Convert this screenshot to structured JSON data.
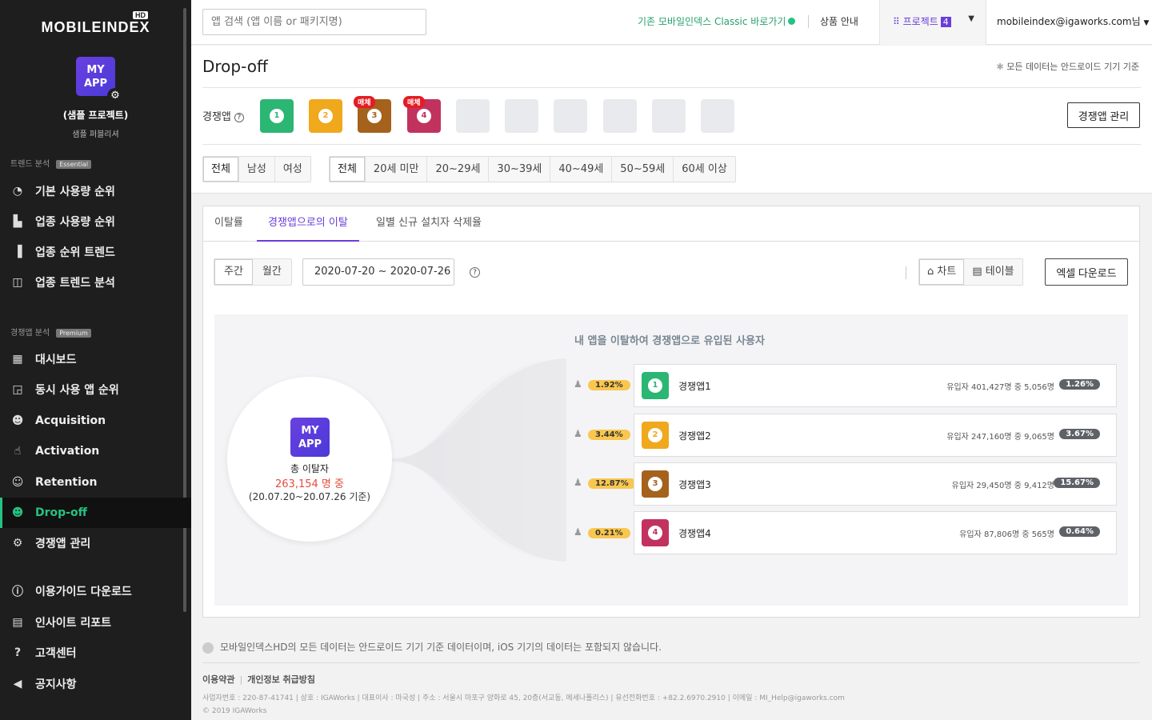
{
  "sidebar": {
    "logo": "MOBILEINDEX",
    "logo_badge": "HD",
    "app_icon_text": "MY\nAPP",
    "project_name": "(샘플 프로젝트)",
    "project_sub": "샘플 퍼블리셔",
    "sections": [
      {
        "title": "트렌드 분석",
        "badge": "Essential"
      },
      {
        "title": "경쟁앱 분석",
        "badge": "Premium"
      }
    ],
    "items": [
      {
        "label": "기본 사용량 순위",
        "icon": "gauge-icon"
      },
      {
        "label": "업종 사용량 순위",
        "icon": "building-icon"
      },
      {
        "label": "업종 순위 트렌드",
        "icon": "bar-chart-icon"
      },
      {
        "label": "업종 트렌드 분석",
        "icon": "trend-chart-icon"
      },
      {
        "label": "대시보드",
        "icon": "dashboard-icon"
      },
      {
        "label": "동시 사용 앱 순위",
        "icon": "overlap-icon"
      },
      {
        "label": "Acquisition",
        "icon": "user-plus-icon"
      },
      {
        "label": "Activation",
        "icon": "hand-pointer-icon"
      },
      {
        "label": "Retention",
        "icon": "user-refresh-icon"
      },
      {
        "label": "Drop-off",
        "icon": "user-minus-icon"
      },
      {
        "label": "경쟁앱 관리",
        "icon": "gear-icon"
      },
      {
        "label": "이용가이드 다운로드",
        "icon": "info-icon"
      },
      {
        "label": "인사이트 리포트",
        "icon": "report-icon"
      },
      {
        "label": "고객센터",
        "icon": "help-icon"
      },
      {
        "label": "공지사항",
        "icon": "megaphone-icon"
      }
    ]
  },
  "topbar": {
    "search_placeholder": "앱 검색 (앱 이름 or 패키지명)",
    "classic_link": "기존 모바일인덱스 Classic 바로가기",
    "product_info": "상품 안내",
    "project_label": "프로젝트",
    "project_count": "4",
    "email": "mobileindex@igaworks.com님"
  },
  "page": {
    "title": "Drop-off",
    "android_note": "모든 데이터는 안드로이드 기기 기준",
    "competitor_label": "경쟁앱",
    "competitor_help": "?",
    "competitors": [
      {
        "num": "1",
        "color": "#2bb673",
        "badge": ""
      },
      {
        "num": "2",
        "color": "#f0a81c",
        "badge": ""
      },
      {
        "num": "3",
        "color": "#a5621c",
        "badge": "매체"
      },
      {
        "num": "4",
        "color": "#c2325e",
        "badge": "매체"
      }
    ],
    "manage_button": "경쟁앱 관리",
    "gender_filters": [
      "전체",
      "남성",
      "여성"
    ],
    "age_filters": [
      "전체",
      "20세 미만",
      "20~29세",
      "30~39세",
      "40~49세",
      "50~59세",
      "60세 이상"
    ]
  },
  "tabs": [
    "이탈률",
    "경쟁앱으로의 이탈",
    "일별 신규 설치자 삭제율"
  ],
  "controls": {
    "period": [
      "주간",
      "월간"
    ],
    "date_range": "2020-07-20 ~ 2020-07-26",
    "help": "?",
    "view_chart": "차트",
    "view_table": "테이블",
    "excel": "엑셀 다운로드"
  },
  "flow": {
    "title": "내 앱을 이탈하여 경쟁앱으로 유입된 사용자",
    "center_app": "MY\nAPP",
    "center_l1": "총 이탈자",
    "center_l2": "263,154 명  중",
    "center_l3": "(20.07.20~20.07.26 기준)",
    "rows": [
      {
        "pct_left": "1.92%",
        "name": "경쟁앱1",
        "num": "1",
        "color": "#2bb673",
        "desc": "유입자 401,427명 중 5,056명",
        "pct_right": "1.26%"
      },
      {
        "pct_left": "3.44%",
        "name": "경쟁앱2",
        "num": "2",
        "color": "#f0a81c",
        "desc": "유입자 247,160명 중 9,065명",
        "pct_right": "3.67%"
      },
      {
        "pct_left": "12.87%",
        "name": "경쟁앱3",
        "num": "3",
        "color": "#a5621c",
        "desc": "유입자 29,450명 중 9,412명",
        "pct_right": "15.67%"
      },
      {
        "pct_left": "0.21%",
        "name": "경쟁앱4",
        "num": "4",
        "color": "#c2325e",
        "desc": "유입자 87,806명 중 565명",
        "pct_right": "0.64%"
      }
    ]
  },
  "footer": {
    "note": "모바일인덱스HD의 모든 데이터는 안드로이드 기기 기준 데이터이며, iOS 기기의 데이터는 포함되지 않습니다.",
    "terms": "이용약관",
    "privacy": "개인정보 취급방침",
    "info": "사업자번호 : 220-87-41741  |  상호 : IGAWorks  |  대표이사 : 마국성  |  주소 : 서울시 마포구 양화로 45, 20층(서교동, 메세나폴리스)  |  유선전화번호 : +82.2.6970.2910  |  이메일 : MI_Help@igaworks.com",
    "copyright": "© 2019 IGAWorks"
  }
}
